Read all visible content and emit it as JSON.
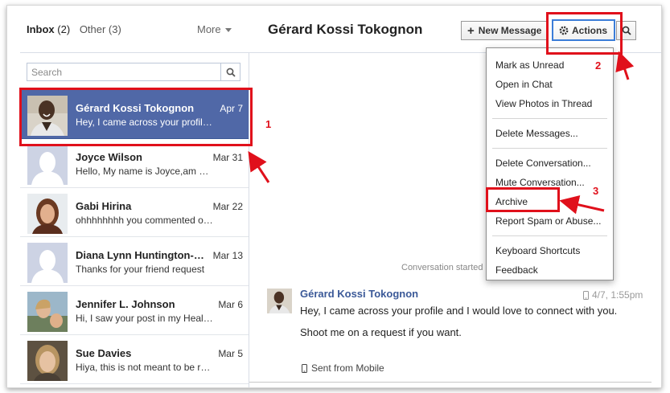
{
  "folders": {
    "inbox_label": "Inbox",
    "inbox_count": "(2)",
    "other_label": "Other (3)",
    "more_label": "More"
  },
  "search": {
    "placeholder": "Search"
  },
  "threads": [
    {
      "name": "Gérard Kossi Tokognon",
      "date": "Apr 7",
      "snippet": "Hey, I came across your profile and I would love to connect with you."
    },
    {
      "name": "Joyce Wilson",
      "date": "Mar 31",
      "snippet": "Hello, My name is Joyce,am writing you"
    },
    {
      "name": "Gabi Hirina",
      "date": "Mar 22",
      "snippet": "ohhhhhhhh you commented on my photo"
    },
    {
      "name": "Diana Lynn Huntington-Smith",
      "date": "Mar 13",
      "snippet": "Thanks for your friend request"
    },
    {
      "name": "Jennifer L. Johnson",
      "date": "Mar 6",
      "snippet": "Hi, I saw your post in my Health group"
    },
    {
      "name": "Sue Davies",
      "date": "Mar 5",
      "snippet": "Hiya, this is not meant to be rude"
    }
  ],
  "conversation": {
    "title": "Gérard Kossi Tokognon",
    "new_message_label": "New Message",
    "actions_label": "Actions",
    "started_text": "Conversation started",
    "message": {
      "sender": "Gérard Kossi Tokognon",
      "time": "4/7, 1:55pm",
      "line1": "Hey, I came across your profile and I would love to connect with you.",
      "line2": "Shoot me on a request if you want.",
      "mobile": "Sent from Mobile"
    }
  },
  "actions_menu": {
    "group1": [
      "Mark as Unread",
      "Open in Chat",
      "View Photos in Thread"
    ],
    "group2": [
      "Delete Messages..."
    ],
    "group3": [
      "Delete Conversation...",
      "Mute Conversation...",
      "Archive",
      "Report Spam or Abuse..."
    ],
    "group4": [
      "Keyboard Shortcuts",
      "Feedback"
    ]
  },
  "annotations": {
    "step1": "1",
    "step2": "2",
    "step3": "3",
    "color": "#e0101b"
  },
  "colors": {
    "selected_row": "#5068a7",
    "link": "#3b5998",
    "actions_border": "#3b7dd8"
  }
}
